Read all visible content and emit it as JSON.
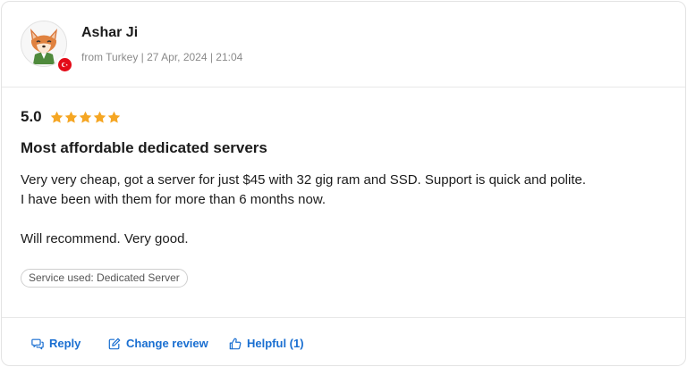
{
  "reviewer": {
    "name": "Ashar Ji",
    "meta": "from Turkey | 27 Apr, 2024 | 21:04",
    "avatar_icon": "fox-avatar-icon",
    "flag_icon": "turkey-flag-icon"
  },
  "review": {
    "rating": "5.0",
    "stars": 5,
    "title": "Most affordable dedicated servers",
    "lines": [
      "Very very cheap, got a server for just $45 with 32 gig ram and SSD. Support is quick and polite.",
      "I have been with them for more than 6 months now.",
      "Will recommend. Very good."
    ],
    "service_tag": "Service used: Dedicated Server"
  },
  "actions": {
    "reply": "Reply",
    "change_review": "Change review",
    "helpful": "Helpful (1)"
  },
  "colors": {
    "accent": "#1a6fd1",
    "star": "#f5a623",
    "flag": "#e30a17"
  }
}
